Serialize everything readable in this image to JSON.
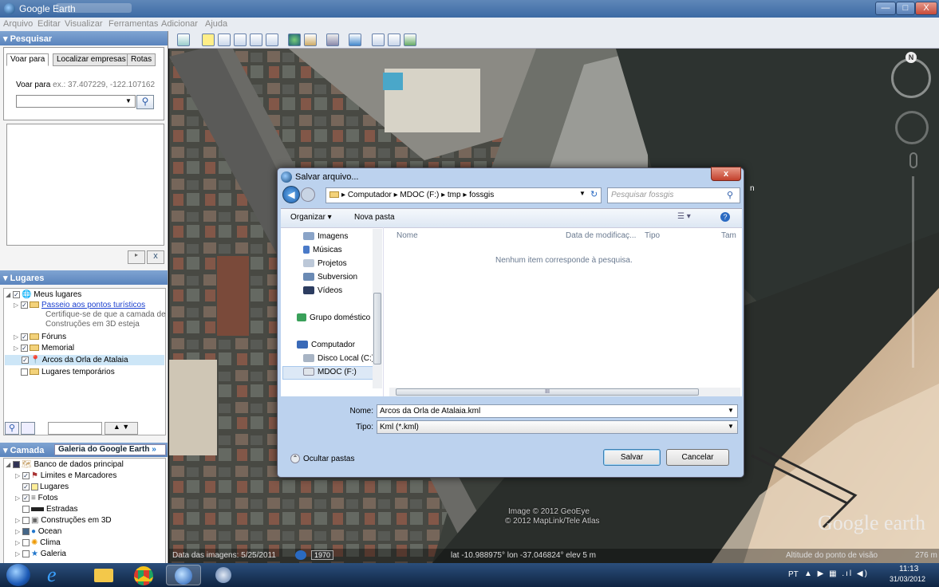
{
  "window": {
    "title": "Google Earth",
    "minimize": "—",
    "maximize": "□",
    "close": "X"
  },
  "menubar": [
    "Arquivo",
    "Editar",
    "Visualizar",
    "Ferramentas",
    "Adicionar",
    "Ajuda"
  ],
  "search_panel": {
    "header": "Pesquisar",
    "tabs": [
      "Voar para",
      "Localizar empresas",
      "Rotas"
    ],
    "fly_label": "Voar para",
    "fly_example": "ex.: 37.407229, -122.107162",
    "input_value": "",
    "search_icon": "magnifier-icon",
    "close_icon": "x-icon",
    "close_label": "x"
  },
  "places_panel": {
    "header": "Lugares",
    "items": [
      {
        "label": "Meus lugares",
        "checked": true
      },
      {
        "label": "Passeio aos pontos turísticos",
        "checked": true,
        "link": true
      },
      {
        "label": "Certifique-se de que a camada de",
        "note": true
      },
      {
        "label": "Construções em 3D esteja",
        "note": true
      },
      {
        "label": "Fóruns",
        "checked": true
      },
      {
        "label": "Memorial",
        "checked": true
      },
      {
        "label": "Arcos da Orla de Atalaia",
        "checked": true,
        "selected": true
      },
      {
        "label": "Lugares temporários",
        "checked": false
      }
    ]
  },
  "layers_panel": {
    "header": "Camada",
    "gallery_button": "Galeria do Google Earth",
    "gallery_arrow": "»",
    "items": [
      {
        "label": "Banco de dados principal",
        "checked": true
      },
      {
        "label": "Limites e Marcadores",
        "checked": true
      },
      {
        "label": "Lugares",
        "checked": true
      },
      {
        "label": "Fotos",
        "checked": true
      },
      {
        "label": "Estradas",
        "checked": false
      },
      {
        "label": "Construções em 3D",
        "checked": false
      },
      {
        "label": "Ocean",
        "checked": false
      },
      {
        "label": "Clima",
        "checked": false
      },
      {
        "label": "Galeria",
        "checked": false
      }
    ]
  },
  "map": {
    "image_credit_1": "Image © 2012 GeoEye",
    "image_credit_2": "© 2012 MapLink/Tele Atlas",
    "logo": "Google earth",
    "compass_label": "N",
    "map_label": "n"
  },
  "status": {
    "imagery_date": "Data das imagens: 5/25/2011",
    "year": "1970",
    "coords": "lat -10.988975° lon -37.046824° elev 5 m",
    "eye_alt_label": "Altitude do ponto de visão",
    "eye_alt_value": "276 m"
  },
  "dialog": {
    "title": "Salvar arquivo...",
    "close": "x",
    "breadcrumb": [
      "Computador",
      "MDOC (F:)",
      "tmp",
      "fossgis"
    ],
    "search_placeholder": "Pesquisar fossgis",
    "organize": "Organizar ▾",
    "new_folder": "Nova pasta",
    "nav_items": [
      "Imagens",
      "Músicas",
      "Projetos",
      "Subversion",
      "Vídeos",
      "Grupo doméstico",
      "Computador",
      "Disco Local (C:)",
      "MDOC (F:)"
    ],
    "columns": [
      "Nome",
      "Data de modificaç...",
      "Tipo",
      "Tam"
    ],
    "empty_message": "Nenhum item corresponde à pesquisa.",
    "hscroll_mark": "III",
    "filename_label": "Nome:",
    "filename_value": "Arcos da Orla de Atalaia.kml",
    "filetype_label": "Tipo:",
    "filetype_value": "Kml (*.kml)",
    "hide_folders": "Ocultar pastas",
    "save": "Salvar",
    "cancel": "Cancelar"
  },
  "taskbar": {
    "lang": "PT",
    "time": "11:13",
    "date": "31/03/2012",
    "tray": "▲ ▶ ▦ .ıl ◀)"
  },
  "colors": {
    "title_blue": "#4a78b0",
    "selected": "#cde6f7",
    "link": "#1a3fcf"
  }
}
